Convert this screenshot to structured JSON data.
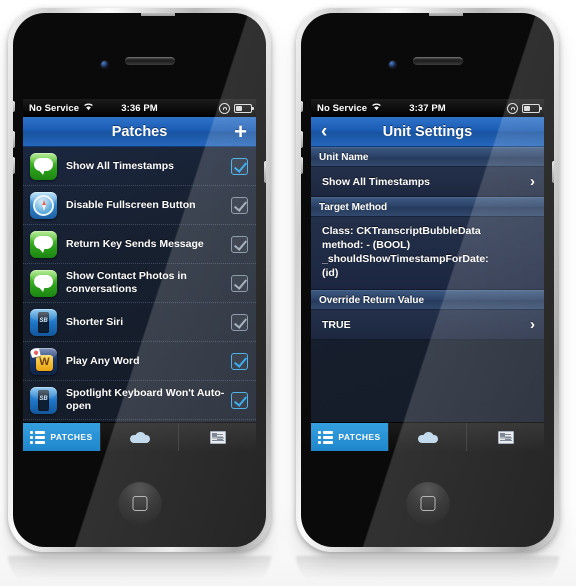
{
  "colors": {
    "accent_blue": "#1f86cc",
    "navbar_blue": "#1a5bb4",
    "list_bg": "#17202f",
    "checkbox_on": "#1ea0ec",
    "checkbox_off": "#9aa6b6",
    "section_header": "#2b4167"
  },
  "phone_left": {
    "statusbar": {
      "carrier": "No Service",
      "time": "3:36 PM",
      "wifi_icon": "wifi-icon",
      "rotation_lock_icon": "rotation-lock-icon",
      "battery_icon": "battery-icon"
    },
    "navbar": {
      "title": "Patches",
      "add_label": "+"
    },
    "rows": [
      {
        "icon": "messages-app-icon",
        "label": "Show All Timestamps",
        "checked": true
      },
      {
        "icon": "safari-app-icon",
        "label": "Disable Fullscreen Button",
        "checked": false
      },
      {
        "icon": "messages-app-icon",
        "label": "Return Key Sends Message",
        "checked": false
      },
      {
        "icon": "messages-app-icon",
        "label": "Show Contact Photos in conversations",
        "checked": false
      },
      {
        "icon": "springboard-app-icon",
        "label": "Shorter Siri",
        "checked": false
      },
      {
        "icon": "words-app-icon",
        "label": "Play Any Word",
        "checked": true
      },
      {
        "icon": "springboard-app-icon",
        "label": "Spotlight Keyboard Won't Auto-open",
        "checked": true
      }
    ],
    "tabbar": [
      {
        "icon": "list-icon",
        "label": "PATCHES",
        "active": true
      },
      {
        "icon": "cloud-icon",
        "label": "",
        "active": false
      },
      {
        "icon": "news-icon",
        "label": "",
        "active": false
      }
    ]
  },
  "phone_right": {
    "statusbar": {
      "carrier": "No Service",
      "time": "3:37 PM",
      "wifi_icon": "wifi-icon",
      "rotation_lock_icon": "rotation-lock-icon",
      "battery_icon": "battery-icon"
    },
    "navbar": {
      "title": "Unit Settings",
      "back_label": "‹"
    },
    "sections": [
      {
        "header": "Unit Name",
        "type": "row",
        "value": "Show All Timestamps",
        "chevron": "›"
      },
      {
        "header": "Target Method",
        "type": "text",
        "value": "Class: CKTranscriptBubbleData\nmethod: - (BOOL)\n_shouldShowTimestampForDate:\n(id)"
      },
      {
        "header": "Override Return Value",
        "type": "row",
        "value": "TRUE",
        "chevron": "›"
      }
    ],
    "tabbar": [
      {
        "icon": "list-icon",
        "label": "PATCHES",
        "active": true
      },
      {
        "icon": "cloud-icon",
        "label": "",
        "active": false
      },
      {
        "icon": "news-icon",
        "label": "",
        "active": false
      }
    ]
  }
}
